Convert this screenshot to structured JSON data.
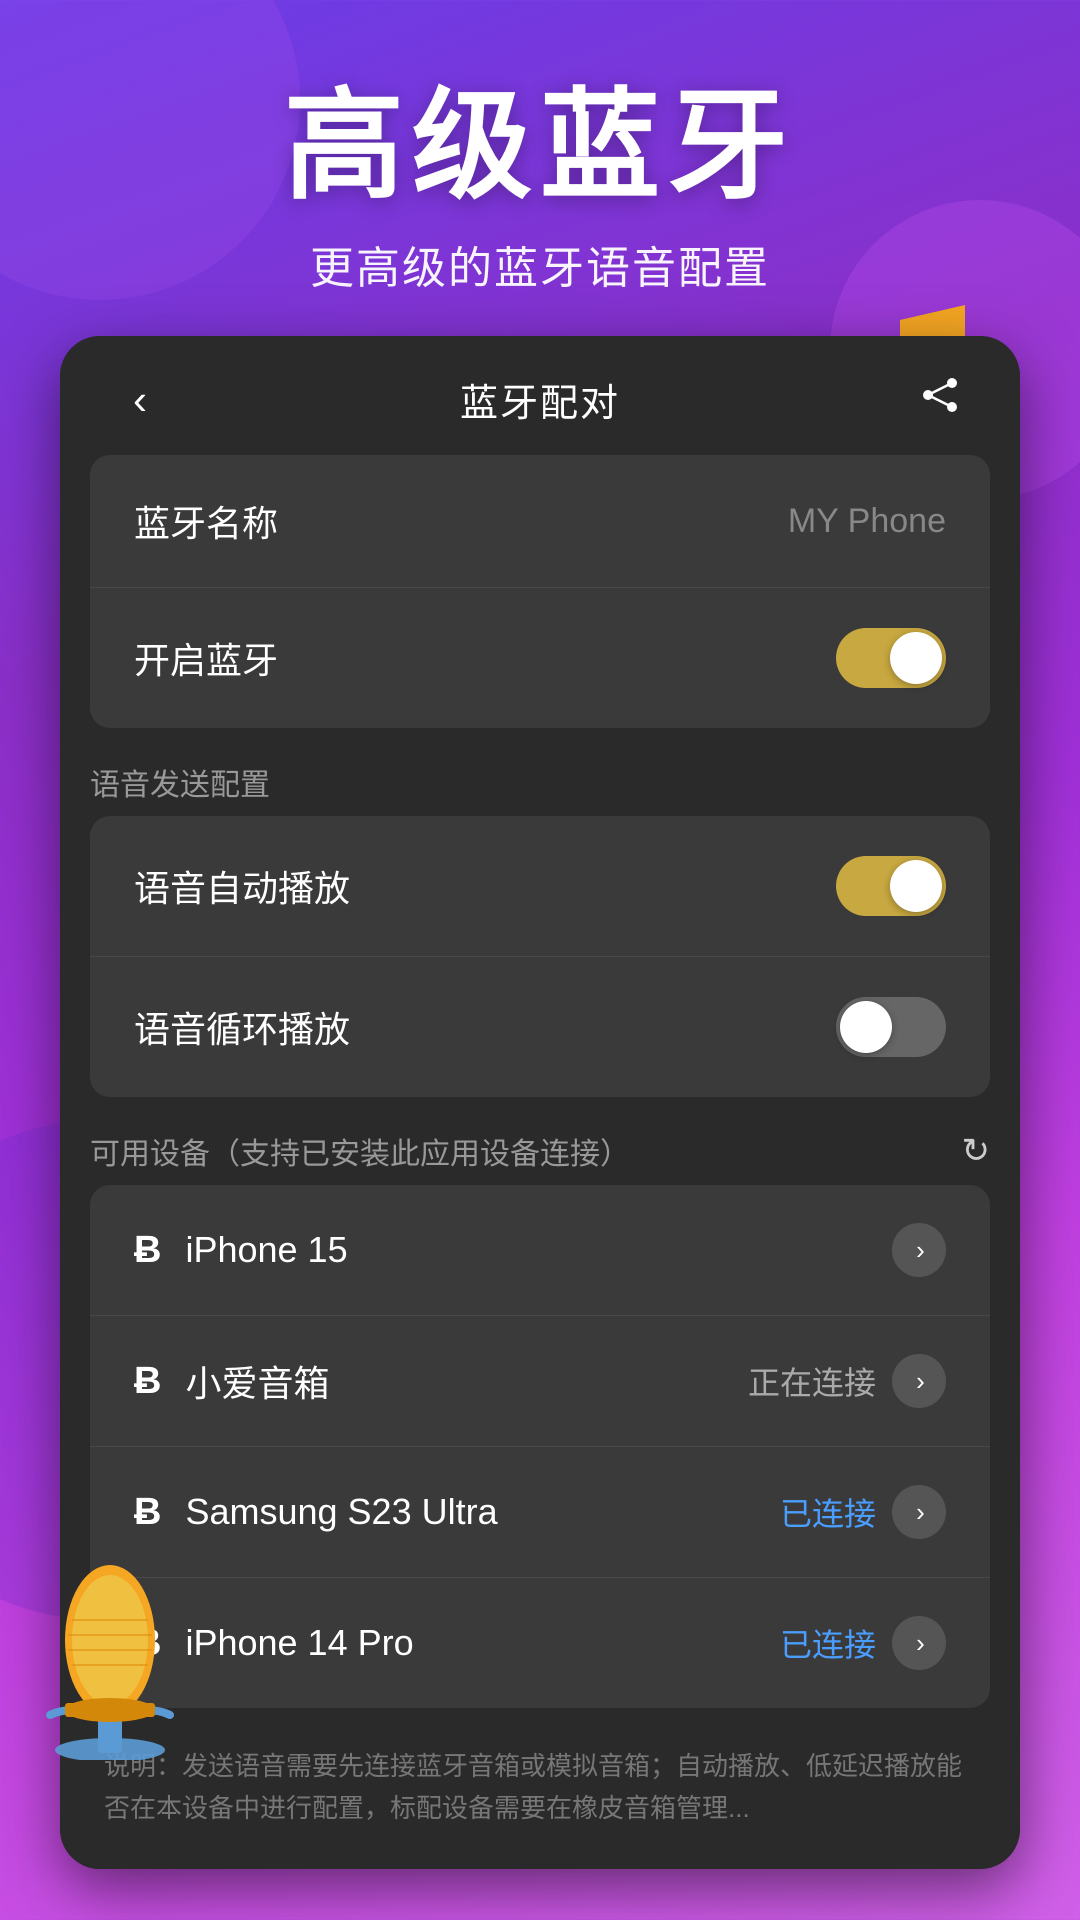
{
  "hero": {
    "title": "高级蓝牙",
    "subtitle": "更高级的蓝牙语音配置"
  },
  "nav": {
    "back_label": "‹",
    "title": "蓝牙配对",
    "share_icon": "share"
  },
  "bluetooth_section": {
    "name_label": "蓝牙名称",
    "name_value": "MY Phone",
    "enable_label": "开启蓝牙",
    "enable_on": true
  },
  "voice_section": {
    "section_label": "语音发送配置",
    "auto_play_label": "语音自动播放",
    "auto_play_on": true,
    "loop_play_label": "语音循环播放",
    "loop_play_on": false
  },
  "devices_section": {
    "section_label": "可用设备（支持已安装此应用设备连接）",
    "devices": [
      {
        "name": "iPhone 15",
        "status": "",
        "status_type": "none"
      },
      {
        "name": "小爱音箱",
        "status": "正在连接",
        "status_type": "connecting"
      },
      {
        "name": "Samsung  S23 Ultra",
        "status": "已连接",
        "status_type": "connected"
      },
      {
        "name": "iPhone 14 Pro",
        "status": "已连接",
        "status_type": "connected"
      }
    ]
  },
  "footer": {
    "text": "说明：发送语音需要先连接蓝牙音箱或模拟音箱；自动播放、低延迟播放能否在本设备中进行配置，标配设备需要在橡皮音箱管理..."
  }
}
